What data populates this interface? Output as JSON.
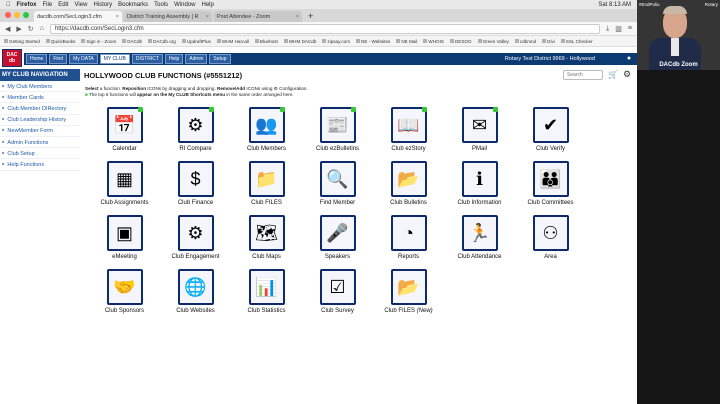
{
  "menubar": {
    "app": "Firefox",
    "menus": [
      "File",
      "Edit",
      "View",
      "History",
      "Bookmarks",
      "Tools",
      "Window",
      "Help"
    ],
    "clock": "Sat 8:13 AM"
  },
  "tabs": [
    {
      "label": "dacdb.com/SecLogin3.cfm",
      "active": true
    },
    {
      "label": "District Training Assembly | R",
      "active": false
    },
    {
      "label": "Post Attendee - Zoom",
      "active": false
    }
  ],
  "new_tab_glyph": "+",
  "url": "https://dacdb.com/SecLogin3.cfm",
  "bookmarks": [
    "Getting Started",
    "QuickBooks",
    "Sign in - Zoom",
    "DACdb",
    "DACdb.org",
    "UpdraftPlus",
    "WHM Harcall",
    "Bluehost",
    "WHM DACdb",
    "zipsay.com",
    "NE - Websites",
    "NE Mail",
    "WHOIS",
    "DESOG",
    "Green Valley",
    "cdbmnd",
    "Divi",
    "SSL Checker"
  ],
  "logo": {
    "line1": "DAC",
    "line2": "db"
  },
  "nav": {
    "buttons": [
      "Home",
      "Find",
      "My DATA",
      "MY CLUB",
      "DISTRICT",
      "Help",
      "Admin",
      "Setup"
    ],
    "active": "MY CLUB",
    "district_text": "Rotary Test District 9969 - Hollywood"
  },
  "sidebar": {
    "title": "MY CLUB NAVIGATION",
    "items": [
      "My Club Members",
      "Member Cards",
      "Club Member DIRectory",
      "Club Leadership History",
      "NewMember Form",
      "Admin Functions",
      "Club Setup",
      "Help Functions"
    ]
  },
  "page": {
    "title": "HOLLYWOOD CLUB FUNCTIONS (#5551212)",
    "search_placeholder": "Search",
    "instr1_pre": "Select",
    "instr1_a": " a function. ",
    "instr1_b": "Reposition",
    "instr1_c": " ICONs by dragging and dropping. ",
    "instr1_d": "Remove/Add",
    "instr1_e": " ICONs using ",
    "instr1_f": " Configuration.",
    "instr2_a": "The top 6 functions will ",
    "instr2_b": "appear on the My CLUB Shortcuts menu",
    "instr2_c": " in the same order arranged here."
  },
  "functions": [
    {
      "label": "Calendar",
      "icon": "calendar-icon",
      "glyph": "📅",
      "dot": true
    },
    {
      "label": "RI Compare",
      "icon": "rotary-wheel-icon",
      "glyph": "⚙",
      "dot": true
    },
    {
      "label": "Club Members",
      "icon": "members-group-icon",
      "glyph": "👥",
      "dot": true
    },
    {
      "label": "Club ezBulletins",
      "icon": "bulletin-icon",
      "glyph": "📰",
      "dot": true
    },
    {
      "label": "Club ezStory",
      "icon": "book-icon",
      "glyph": "📖",
      "dot": true
    },
    {
      "label": "PMail",
      "icon": "envelope-icon",
      "glyph": "✉",
      "dot": true
    },
    {
      "label": "Club Verify",
      "icon": "checklist-icon",
      "glyph": "✔",
      "dot": false
    },
    {
      "label": "Club Assignments",
      "icon": "assignments-icon",
      "glyph": "▦",
      "dot": false
    },
    {
      "label": "Club Finance",
      "icon": "finance-icon",
      "glyph": "$",
      "dot": false
    },
    {
      "label": "Club FILES",
      "icon": "folder-icon",
      "glyph": "📁",
      "dot": false
    },
    {
      "label": "Find Member",
      "icon": "magnifier-icon",
      "glyph": "🔍",
      "dot": false
    },
    {
      "label": "Club Bulletins",
      "icon": "bulletin-folder-icon",
      "glyph": "📂",
      "dot": false
    },
    {
      "label": "Club Information",
      "icon": "information-icon",
      "glyph": "ℹ",
      "dot": false
    },
    {
      "label": "Club Committees",
      "icon": "committees-icon",
      "glyph": "👪",
      "dot": false
    },
    {
      "label": "eMeeting",
      "icon": "chip-icon",
      "glyph": "▣",
      "dot": false
    },
    {
      "label": "Club Engagement",
      "icon": "gears-person-icon",
      "glyph": "⚙",
      "dot": false
    },
    {
      "label": "Club Maps",
      "icon": "map-icon",
      "glyph": "🗺",
      "dot": false
    },
    {
      "label": "Speakers",
      "icon": "podium-icon",
      "glyph": "🎤",
      "dot": false
    },
    {
      "label": "Reports",
      "icon": "pie-chart-icon",
      "glyph": "◔",
      "dot": false
    },
    {
      "label": "Club Attendance",
      "icon": "person-check-icon",
      "glyph": "🏃",
      "dot": false
    },
    {
      "label": "Area",
      "icon": "area-people-icon",
      "glyph": "⚇",
      "dot": false
    },
    {
      "label": "Club Sponsors",
      "icon": "handshake-icon",
      "glyph": "🤝",
      "dot": false
    },
    {
      "label": "Club Websites",
      "icon": "globe-icon",
      "glyph": "🌐",
      "dot": false
    },
    {
      "label": "Club Statistics",
      "icon": "bar-chart-icon",
      "glyph": "📊",
      "dot": false
    },
    {
      "label": "Club Survey",
      "icon": "survey-icon",
      "glyph": "☑",
      "dot": false
    },
    {
      "label": "Club FILES",
      "label_suffix": "(New)",
      "icon": "new-folder-icon",
      "glyph": "📂",
      "dot": false
    }
  ],
  "webcam": {
    "name": "#EndPolio",
    "org": "Rotary",
    "label": "DACdb Zoom"
  },
  "colors": {
    "nav": "#0c3a73",
    "sidebar_title": "#1f4f8f",
    "icon_border": "#0d2a6e",
    "logo_red": "#c8102e"
  }
}
